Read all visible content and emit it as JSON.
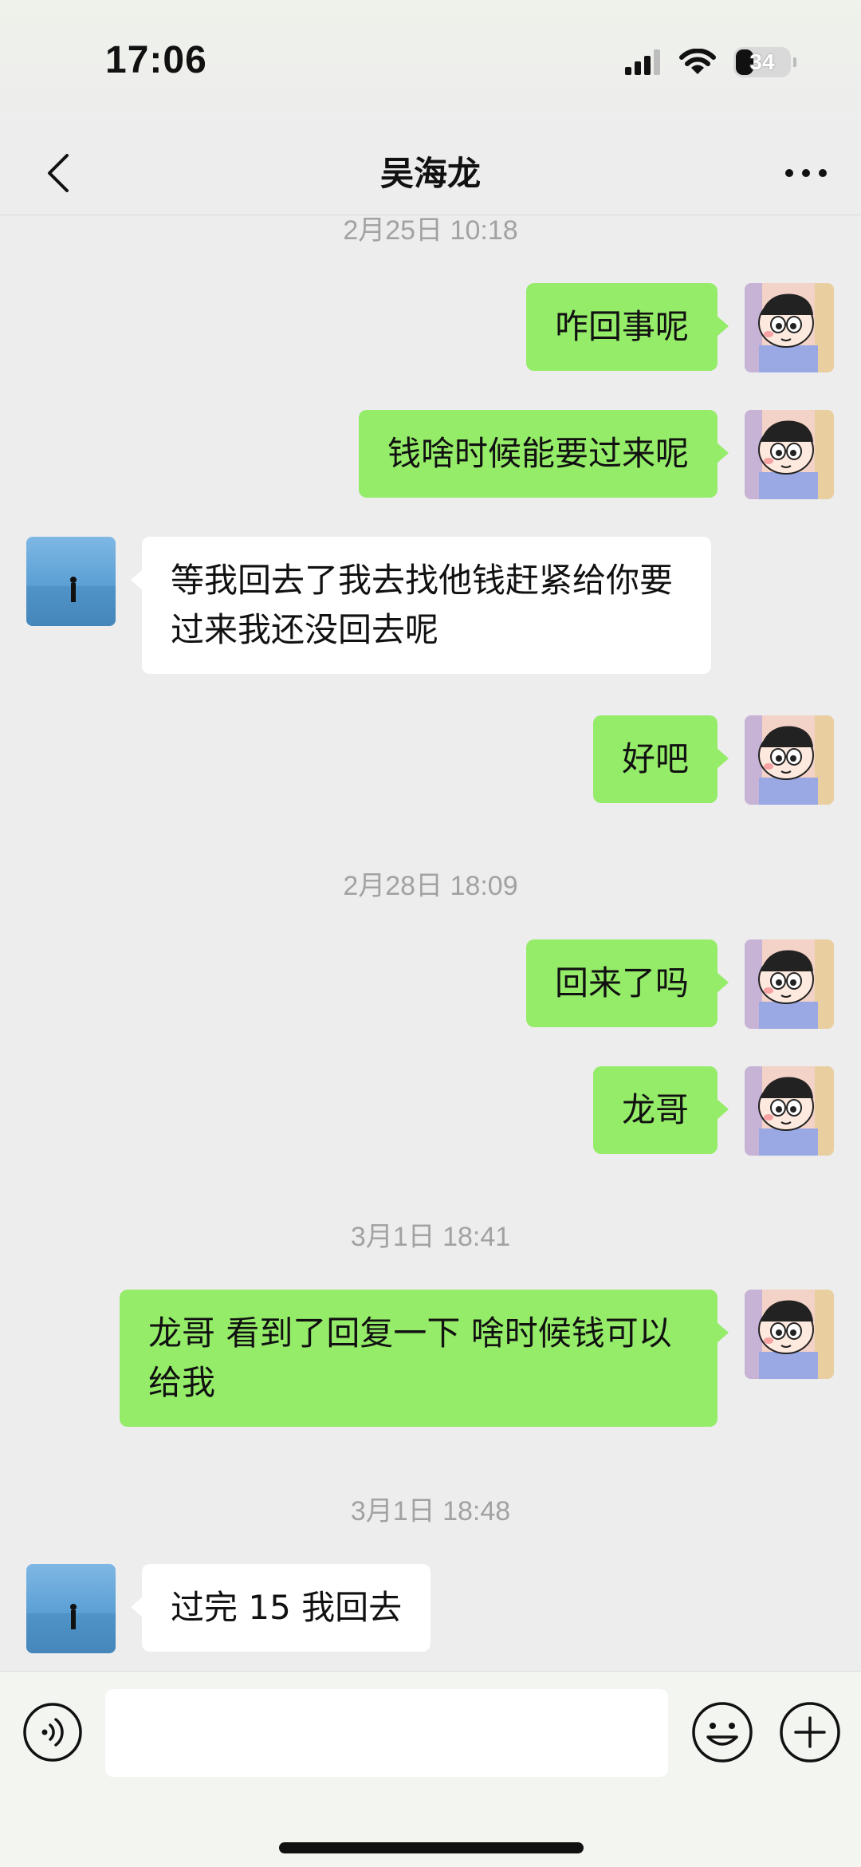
{
  "status_bar": {
    "time": "17:06",
    "battery": "34",
    "icons": [
      "signal-icon",
      "wifi-icon",
      "battery-icon"
    ]
  },
  "nav": {
    "title": "吴海龙",
    "back_icon": "chevron-left-icon",
    "more_icon": "more-icon"
  },
  "chat": {
    "timestamps": [
      "2月25日 10:18",
      "2月28日 18:09",
      "3月1日 18:41",
      "3月1日 18:48"
    ],
    "messages": [
      {
        "sender": "me",
        "text": "咋回事呢"
      },
      {
        "sender": "me",
        "text": "钱啥时候能要过来呢"
      },
      {
        "sender": "them",
        "text": "等我回去了我去找他钱赶紧给你要过来我还没回去呢"
      },
      {
        "sender": "me",
        "text": "好吧"
      },
      {
        "sender": "me",
        "text": "回来了吗"
      },
      {
        "sender": "me",
        "text": "龙哥"
      },
      {
        "sender": "me",
        "text": "龙哥 看到了回复一下  啥时候钱可以给我"
      },
      {
        "sender": "them",
        "text": "过完 15 我回去"
      }
    ]
  },
  "input_bar": {
    "voice_icon": "voice-icon",
    "emoji_icon": "emoji-icon",
    "plus_icon": "plus-icon",
    "text_value": ""
  },
  "colors": {
    "background": "#ededed",
    "sent_bubble": "#95ec69",
    "received_bubble": "#ffffff",
    "timestamp_text": "#a2a2a2"
  }
}
